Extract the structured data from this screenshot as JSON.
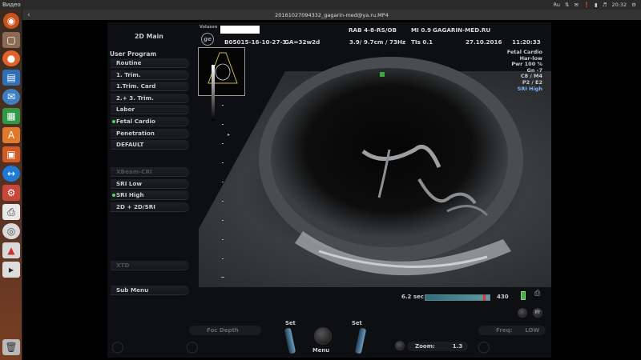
{
  "topbar": {
    "app_name": "Видео",
    "time": "20:32",
    "tray_icons": [
      "keyboard-layout-icon",
      "network-icon",
      "mail-icon",
      "bluetooth-icon",
      "battery-icon",
      "volume-icon"
    ],
    "keyboard_layout": "Ru"
  },
  "window": {
    "title": "20161027094332_gagarin-med@ya.ru.MP4"
  },
  "launcher": {
    "items": [
      "ubuntu-dash-icon",
      "files-icon",
      "firefox-icon",
      "writer-icon",
      "thunderbird-icon",
      "calc-icon",
      "software-center-icon",
      "impress-icon",
      "teamviewer-icon",
      "settings-icon",
      "printer-icon",
      "disc-icon",
      "drawing-icon",
      "video-icon",
      "trash-icon"
    ]
  },
  "header": {
    "volusion_label": "Voluson",
    "probe": "RAB 4-8-RS/OB",
    "mi": "MI  0.9",
    "site": "GAGARIN-MED.RU",
    "patient_id": "B05015-16-10-27-3",
    "ga": "GA=32w2d",
    "depth_freq": "3.9/ 9.7cm / 73Hz",
    "tis": "TIs  0.1",
    "date": "27.10.2016",
    "time": "11:20:33"
  },
  "left_menu": {
    "title": "2D Main",
    "user_program_label": "User Program",
    "programs": [
      {
        "label": "Routine",
        "active": false
      },
      {
        "label": "1. Trim.",
        "active": false
      },
      {
        "label": "1.Trim. Card",
        "active": false
      },
      {
        "label": "2.+ 3. Trim.",
        "active": false
      },
      {
        "label": "Labor",
        "active": false
      },
      {
        "label": "Fetal Cardio",
        "active": true
      },
      {
        "label": "Penetration",
        "active": false
      },
      {
        "label": "DEFAULT",
        "active": false
      }
    ],
    "modes": [
      {
        "label": "XBeam-CRI",
        "active": false,
        "disabled": true
      },
      {
        "label": "SRI Low",
        "active": false,
        "disabled": false
      },
      {
        "label": "SRI High",
        "active": true,
        "disabled": false
      },
      {
        "label": "2D + 2D/SRI",
        "active": false,
        "disabled": false
      }
    ],
    "xtd": "XTD",
    "sub_menu": "Sub Menu"
  },
  "params": {
    "lines": [
      "Fetal Cardio",
      "Har-low",
      "Pwr 100 %",
      "Gn  -7",
      "C8 / M4",
      "P2 / E2"
    ],
    "sri": "SRI High"
  },
  "status": {
    "cine_time": "6.2 sec",
    "frame": "430",
    "cine_position_fraction": 0.92
  },
  "controls": {
    "foc_depth": "Foc Depth",
    "set_left": "Set",
    "set_right": "Set",
    "menu": "Menu",
    "zoom_label": "Zoom:",
    "zoom_value": "1.3",
    "freq_label": "Freq:",
    "freq_value": "LOW"
  },
  "colors": {
    "accent_green": "#5ad25a",
    "sri_blue": "#7cb4ff",
    "cine_marker": "#d23a3a"
  }
}
